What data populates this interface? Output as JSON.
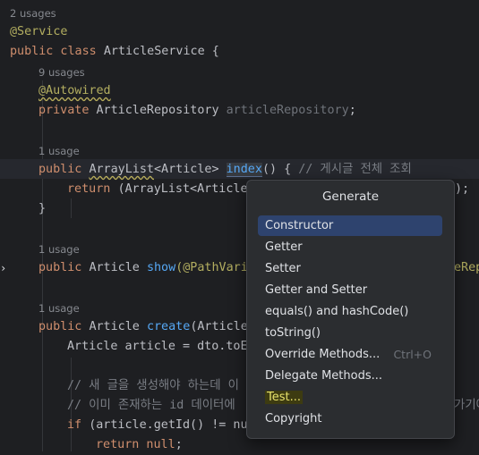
{
  "editor": {
    "usage_hints": [
      "2 usages",
      "9 usages",
      "1 usage",
      "1 usage",
      "1 usage"
    ],
    "lines": {
      "l1": "@Service",
      "l2_kw": "public class ",
      "l2_name": "ArticleService {",
      "l3_ann": "@Autowired",
      "l4_kw": "private ",
      "l4_type": "ArticleRepository ",
      "l4_field": "articleRepository",
      "l4_semi": ";",
      "l5_kw": "public ",
      "l5_type": "ArrayList",
      "l5_gen": "<Article> ",
      "l5_fn": "index",
      "l5_rest": "() { ",
      "l5_cmt": "// 게시글 전체 조회",
      "l6_kw": "return ",
      "l6_rest": "(ArrayList<Article",
      "l6_end": ");",
      "l7": "}",
      "l8_kw": "public ",
      "l8_type": "Article ",
      "l8_fn": "show",
      "l8_rest": "(@PathVari",
      "l8_end": "eRep",
      "l9_kw": "public ",
      "l9_type": "Article ",
      "l9_fn": "create",
      "l9_rest": "(Article",
      "l10": "Article article = dto.toE",
      "l11": "// 새 글을 생성해야 하는데 이",
      "l12": "// 이미 존재하는 id 데이터에",
      "l12_end": "가기에",
      "l13_kw": "if ",
      "l13_rest": "(article.getId() != nu",
      "l14_kw": "return null",
      "l14_rest": ";"
    }
  },
  "popup": {
    "title": "Generate",
    "items": [
      {
        "label": "Constructor",
        "shortcut": ""
      },
      {
        "label": "Getter",
        "shortcut": ""
      },
      {
        "label": "Setter",
        "shortcut": ""
      },
      {
        "label": "Getter and Setter",
        "shortcut": ""
      },
      {
        "label": "equals() and hashCode()",
        "shortcut": ""
      },
      {
        "label": "toString()",
        "shortcut": ""
      },
      {
        "label": "Override Methods...",
        "shortcut": "Ctrl+O"
      },
      {
        "label": "Delegate Methods...",
        "shortcut": ""
      },
      {
        "label": "Test...",
        "shortcut": ""
      },
      {
        "label": "Copyright",
        "shortcut": ""
      }
    ],
    "selected_index": 0
  },
  "colors": {
    "background": "#1e1f22",
    "keyword": "#cf8e6d",
    "annotation": "#b3ae60",
    "method": "#56a8f5",
    "field": "#c77dbb",
    "comment": "#7a7e85",
    "selection": "#2e436e"
  },
  "icons": {
    "gutter": "run-arrow-icon"
  }
}
